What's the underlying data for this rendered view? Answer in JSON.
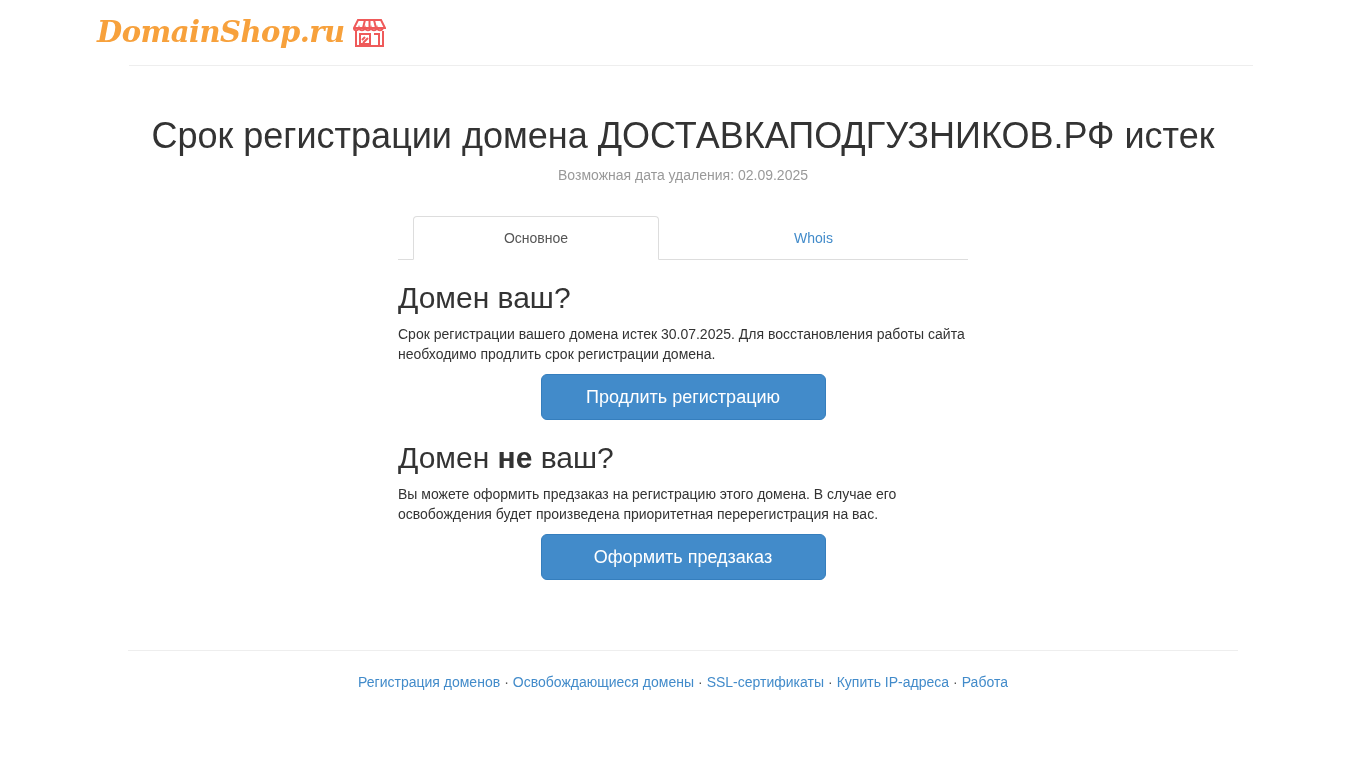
{
  "logo": {
    "text": "DomainShop.ru"
  },
  "title": "Срок регистрации домена ДОСТАВКАПОДГУЗНИКОВ.РФ истек",
  "subtitle": "Возможная дата удаления: 02.09.2025",
  "tabs": [
    {
      "label": "Основное",
      "selected": true
    },
    {
      "label": "Whois",
      "selected": false
    }
  ],
  "sections": [
    {
      "heading": "Домен ваш?",
      "text": "Срок регистрации вашего домена истек 30.07.2025. Для восстановления работы сайта необходимо продлить срок регистрации домена.",
      "button": "Продлить регистрацию"
    },
    {
      "heading": "Домен **не** ваш?",
      "text": "Вы можете оформить предзаказ на регистрацию этого домена. В случае его освобождения будет произведена приоритетная перерегистрация на вас.",
      "button": "Оформить предзаказ"
    }
  ],
  "footer": {
    "links": [
      "Регистрация доменов",
      "Освобождающиеся домены",
      "SSL-сертификаты",
      "Купить IP-адреса",
      "Работа"
    ],
    "separators": [
      "·",
      "·",
      "·",
      "·"
    ]
  }
}
